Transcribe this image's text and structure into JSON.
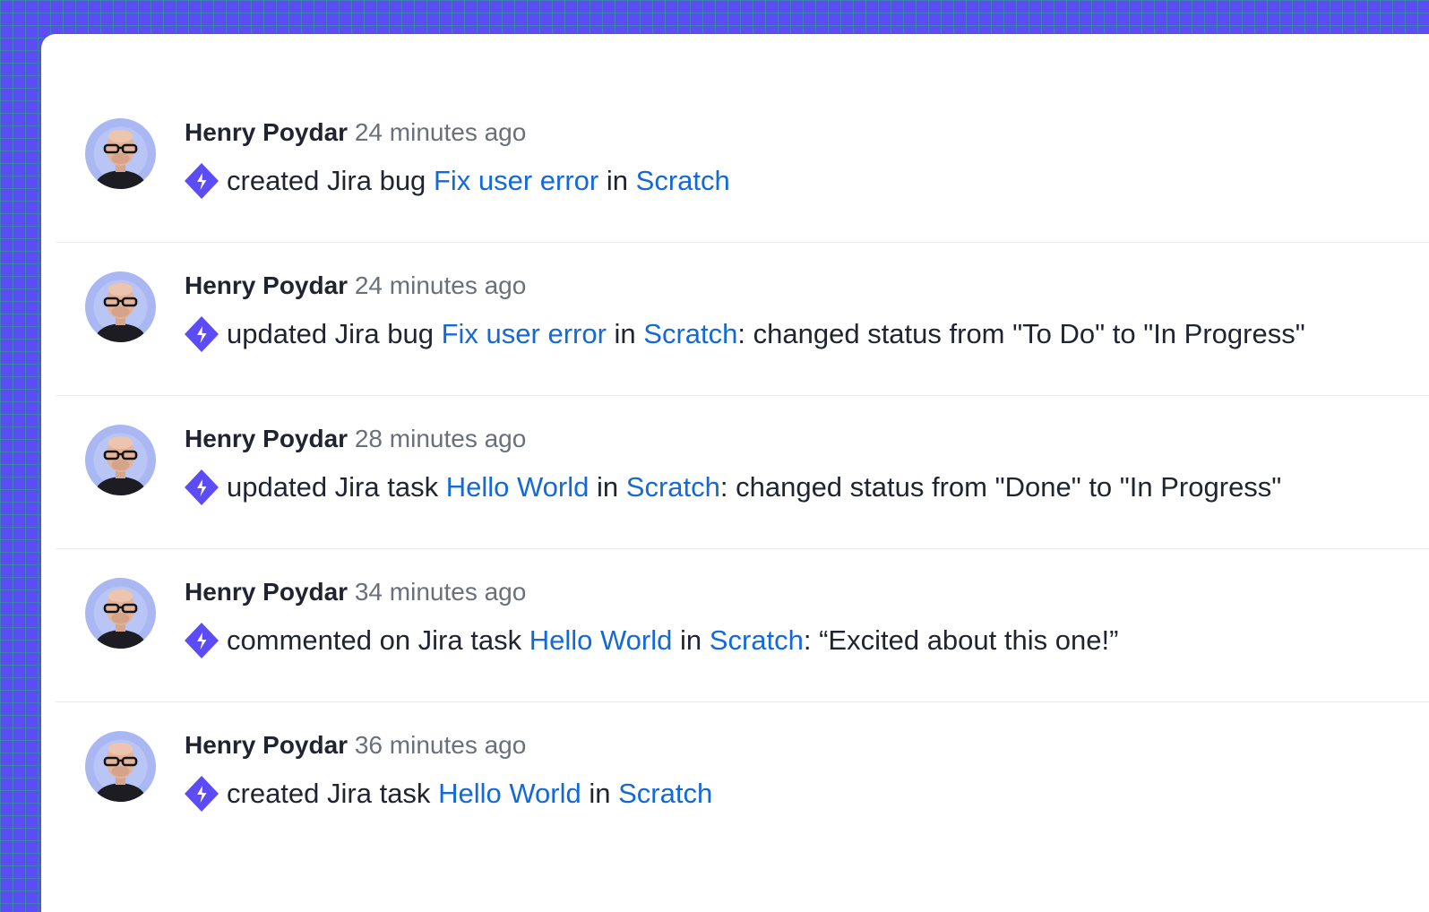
{
  "colors": {
    "background": "#5b4cf6",
    "grid": "#28aa78",
    "card": "#ffffff",
    "link": "#1469d6",
    "text": "#1f2430",
    "muted": "#69707c",
    "jira_icon": "#5b4cf6"
  },
  "feed": [
    {
      "author": "Henry Poydar",
      "time": "24 minutes ago",
      "icon": "jira-icon",
      "verb": "created Jira bug",
      "issue": "Fix user error",
      "joiner": "in",
      "project": "Scratch",
      "detail": ""
    },
    {
      "author": "Henry Poydar",
      "time": "24 minutes ago",
      "icon": "jira-icon",
      "verb": "updated Jira bug",
      "issue": "Fix user error",
      "joiner": "in",
      "project": "Scratch",
      "detail": ": changed status from \"To Do\" to \"In Progress\""
    },
    {
      "author": "Henry Poydar",
      "time": "28 minutes ago",
      "icon": "jira-icon",
      "verb": "updated Jira task",
      "issue": "Hello World",
      "joiner": "in",
      "project": "Scratch",
      "detail": ": changed status from \"Done\" to \"In Progress\""
    },
    {
      "author": "Henry Poydar",
      "time": "34 minutes ago",
      "icon": "jira-icon",
      "verb": "commented on Jira task",
      "issue": "Hello World",
      "joiner": "in",
      "project": "Scratch",
      "detail": ": “Excited about this one!”"
    },
    {
      "author": "Henry Poydar",
      "time": "36 minutes ago",
      "icon": "jira-icon",
      "verb": "created Jira task",
      "issue": "Hello World",
      "joiner": "in",
      "project": "Scratch",
      "detail": ""
    }
  ]
}
